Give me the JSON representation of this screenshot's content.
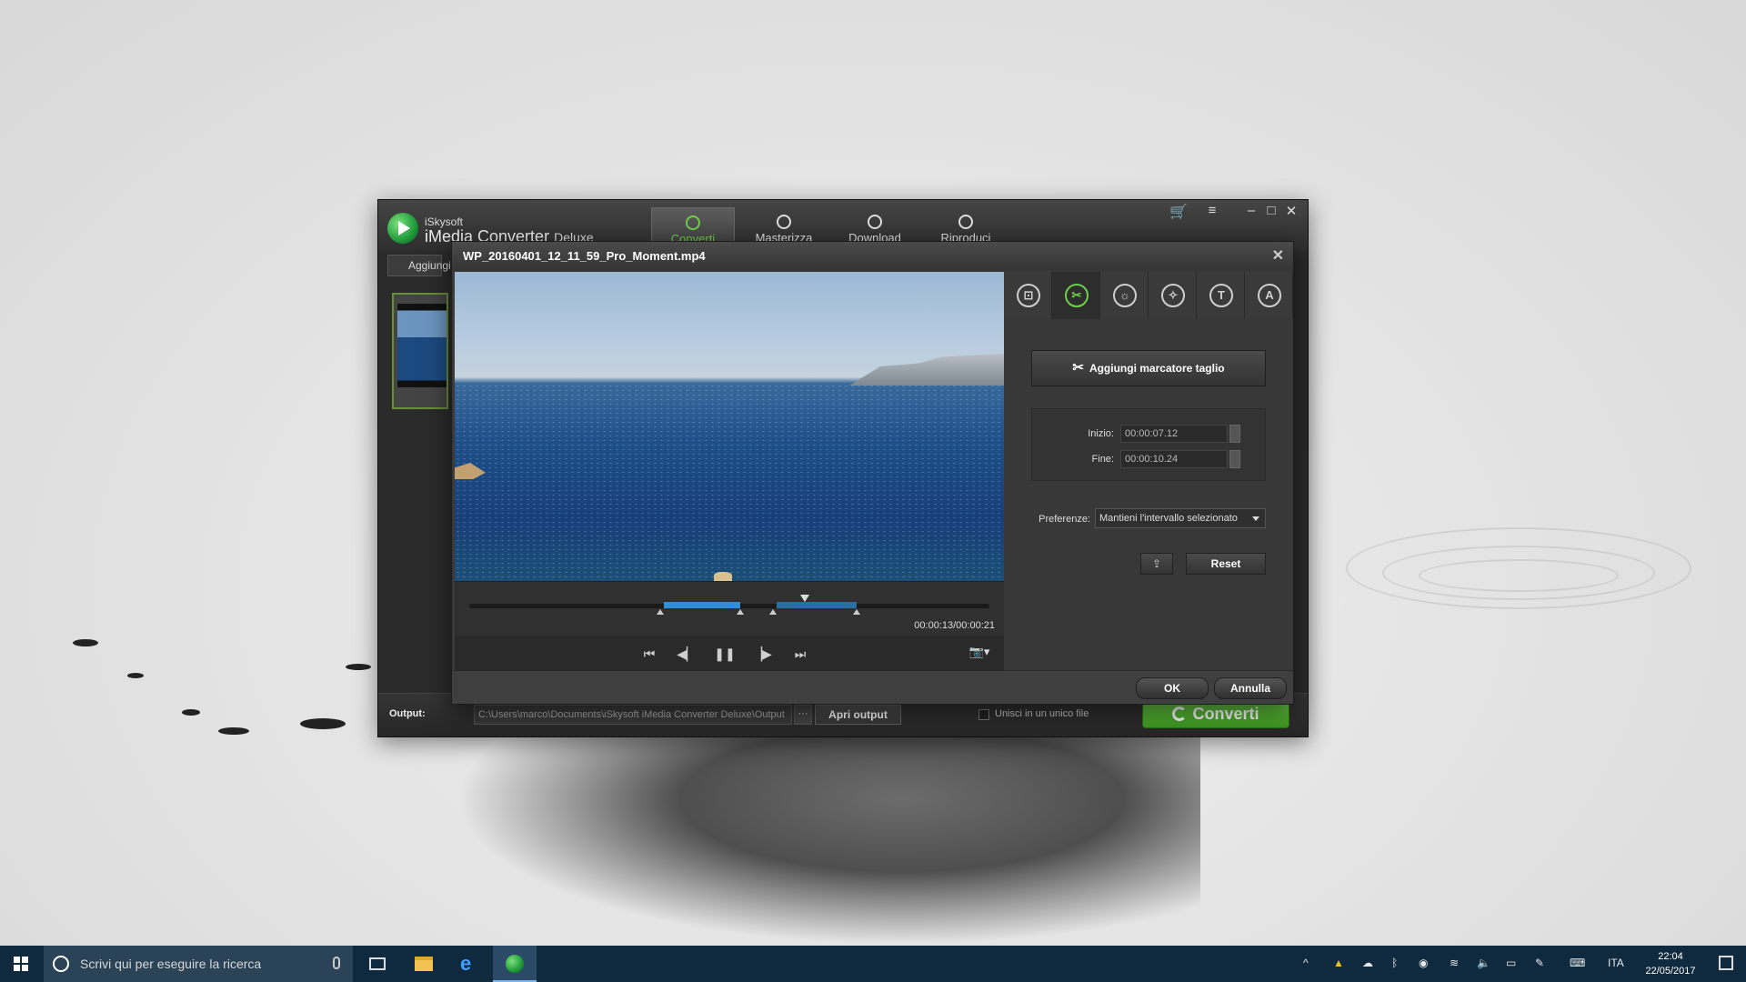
{
  "app": {
    "brand_small": "iSkysoft",
    "brand_name": "iMedia Converter",
    "brand_edition": "Deluxe",
    "tabs": [
      {
        "label": "Converti",
        "active": true
      },
      {
        "label": "Masterizza",
        "active": false
      },
      {
        "label": "Download",
        "active": false
      },
      {
        "label": "Riproduci",
        "active": false
      }
    ],
    "add_button_label": "Aggiungi",
    "output_label": "Output:",
    "output_path": "C:\\Users\\marco\\Documents\\iSkysoft iMedia Converter Deluxe\\Output",
    "output_browse": "···",
    "open_output_label": "Apri output",
    "merge_label": "Unisci in un unico file",
    "convert_label": "Converti"
  },
  "dialog": {
    "title": "WP_20160401_12_11_59_Pro_Moment.mp4",
    "close_glyph": "✕",
    "time_readout": "00:00:13/00:00:21",
    "tools": [
      {
        "name": "crop-tool-icon",
        "glyph": "⊡",
        "active": false
      },
      {
        "name": "trim-tool-icon",
        "glyph": "✂",
        "active": true
      },
      {
        "name": "effect-tool-icon",
        "glyph": "☼",
        "active": false
      },
      {
        "name": "enhance-tool-icon",
        "glyph": "✧",
        "active": false
      },
      {
        "name": "watermark-tool-icon",
        "glyph": "T",
        "active": false
      },
      {
        "name": "subtitle-tool-icon",
        "glyph": "A",
        "active": false
      }
    ],
    "trim": {
      "add_marker_label": "Aggiungi marcatore taglio",
      "start_label": "Inizio:",
      "start_value": "00:00:07.12",
      "end_label": "Fine:",
      "end_value": "00:00:10.24",
      "pref_label": "Preferenze:",
      "pref_value": "Mantieni l'intervallo selezionato",
      "reset_label": "Reset"
    },
    "ok_label": "OK",
    "cancel_label": "Annulla"
  },
  "taskbar": {
    "search_placeholder": "Scrivi qui per eseguire la ricerca",
    "language": "ITA",
    "time": "22:04",
    "date": "22/05/2017"
  },
  "colors": {
    "accent_green": "#6fd04a",
    "trim_blue": "#2f8fd6",
    "taskbar": "#0f2a3e"
  }
}
